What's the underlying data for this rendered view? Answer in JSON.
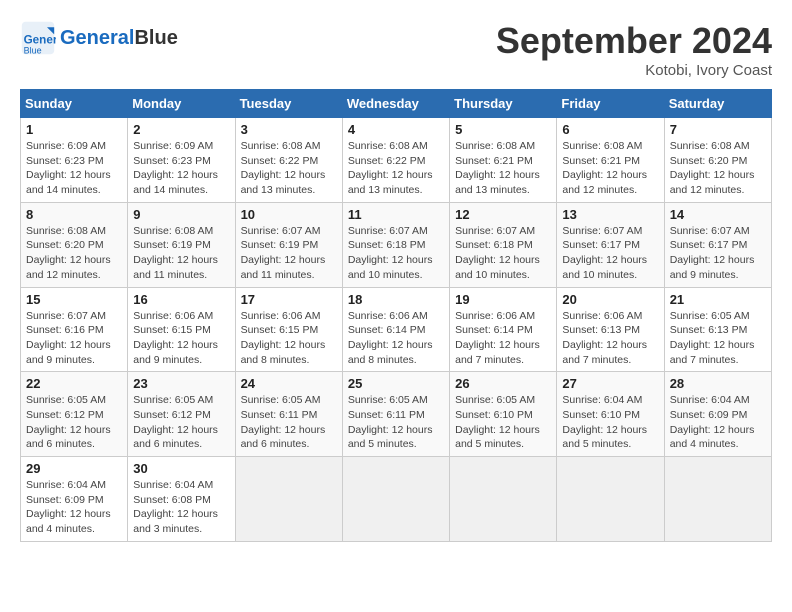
{
  "header": {
    "logo_line1": "General",
    "logo_line2": "Blue",
    "month": "September 2024",
    "location": "Kotobi, Ivory Coast"
  },
  "weekdays": [
    "Sunday",
    "Monday",
    "Tuesday",
    "Wednesday",
    "Thursday",
    "Friday",
    "Saturday"
  ],
  "weeks": [
    [
      {
        "day": "1",
        "info": "Sunrise: 6:09 AM\nSunset: 6:23 PM\nDaylight: 12 hours\nand 14 minutes."
      },
      {
        "day": "2",
        "info": "Sunrise: 6:09 AM\nSunset: 6:23 PM\nDaylight: 12 hours\nand 14 minutes."
      },
      {
        "day": "3",
        "info": "Sunrise: 6:08 AM\nSunset: 6:22 PM\nDaylight: 12 hours\nand 13 minutes."
      },
      {
        "day": "4",
        "info": "Sunrise: 6:08 AM\nSunset: 6:22 PM\nDaylight: 12 hours\nand 13 minutes."
      },
      {
        "day": "5",
        "info": "Sunrise: 6:08 AM\nSunset: 6:21 PM\nDaylight: 12 hours\nand 13 minutes."
      },
      {
        "day": "6",
        "info": "Sunrise: 6:08 AM\nSunset: 6:21 PM\nDaylight: 12 hours\nand 12 minutes."
      },
      {
        "day": "7",
        "info": "Sunrise: 6:08 AM\nSunset: 6:20 PM\nDaylight: 12 hours\nand 12 minutes."
      }
    ],
    [
      {
        "day": "8",
        "info": "Sunrise: 6:08 AM\nSunset: 6:20 PM\nDaylight: 12 hours\nand 12 minutes."
      },
      {
        "day": "9",
        "info": "Sunrise: 6:08 AM\nSunset: 6:19 PM\nDaylight: 12 hours\nand 11 minutes."
      },
      {
        "day": "10",
        "info": "Sunrise: 6:07 AM\nSunset: 6:19 PM\nDaylight: 12 hours\nand 11 minutes."
      },
      {
        "day": "11",
        "info": "Sunrise: 6:07 AM\nSunset: 6:18 PM\nDaylight: 12 hours\nand 10 minutes."
      },
      {
        "day": "12",
        "info": "Sunrise: 6:07 AM\nSunset: 6:18 PM\nDaylight: 12 hours\nand 10 minutes."
      },
      {
        "day": "13",
        "info": "Sunrise: 6:07 AM\nSunset: 6:17 PM\nDaylight: 12 hours\nand 10 minutes."
      },
      {
        "day": "14",
        "info": "Sunrise: 6:07 AM\nSunset: 6:17 PM\nDaylight: 12 hours\nand 9 minutes."
      }
    ],
    [
      {
        "day": "15",
        "info": "Sunrise: 6:07 AM\nSunset: 6:16 PM\nDaylight: 12 hours\nand 9 minutes."
      },
      {
        "day": "16",
        "info": "Sunrise: 6:06 AM\nSunset: 6:15 PM\nDaylight: 12 hours\nand 9 minutes."
      },
      {
        "day": "17",
        "info": "Sunrise: 6:06 AM\nSunset: 6:15 PM\nDaylight: 12 hours\nand 8 minutes."
      },
      {
        "day": "18",
        "info": "Sunrise: 6:06 AM\nSunset: 6:14 PM\nDaylight: 12 hours\nand 8 minutes."
      },
      {
        "day": "19",
        "info": "Sunrise: 6:06 AM\nSunset: 6:14 PM\nDaylight: 12 hours\nand 7 minutes."
      },
      {
        "day": "20",
        "info": "Sunrise: 6:06 AM\nSunset: 6:13 PM\nDaylight: 12 hours\nand 7 minutes."
      },
      {
        "day": "21",
        "info": "Sunrise: 6:05 AM\nSunset: 6:13 PM\nDaylight: 12 hours\nand 7 minutes."
      }
    ],
    [
      {
        "day": "22",
        "info": "Sunrise: 6:05 AM\nSunset: 6:12 PM\nDaylight: 12 hours\nand 6 minutes."
      },
      {
        "day": "23",
        "info": "Sunrise: 6:05 AM\nSunset: 6:12 PM\nDaylight: 12 hours\nand 6 minutes."
      },
      {
        "day": "24",
        "info": "Sunrise: 6:05 AM\nSunset: 6:11 PM\nDaylight: 12 hours\nand 6 minutes."
      },
      {
        "day": "25",
        "info": "Sunrise: 6:05 AM\nSunset: 6:11 PM\nDaylight: 12 hours\nand 5 minutes."
      },
      {
        "day": "26",
        "info": "Sunrise: 6:05 AM\nSunset: 6:10 PM\nDaylight: 12 hours\nand 5 minutes."
      },
      {
        "day": "27",
        "info": "Sunrise: 6:04 AM\nSunset: 6:10 PM\nDaylight: 12 hours\nand 5 minutes."
      },
      {
        "day": "28",
        "info": "Sunrise: 6:04 AM\nSunset: 6:09 PM\nDaylight: 12 hours\nand 4 minutes."
      }
    ],
    [
      {
        "day": "29",
        "info": "Sunrise: 6:04 AM\nSunset: 6:09 PM\nDaylight: 12 hours\nand 4 minutes."
      },
      {
        "day": "30",
        "info": "Sunrise: 6:04 AM\nSunset: 6:08 PM\nDaylight: 12 hours\nand 3 minutes."
      },
      {
        "day": "",
        "info": ""
      },
      {
        "day": "",
        "info": ""
      },
      {
        "day": "",
        "info": ""
      },
      {
        "day": "",
        "info": ""
      },
      {
        "day": "",
        "info": ""
      }
    ]
  ]
}
